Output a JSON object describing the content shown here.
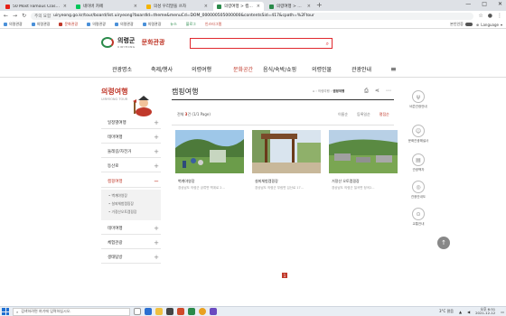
{
  "browser": {
    "tabs": [
      {
        "label": "50 Most Famous Classical I",
        "active": false,
        "favicon_color": "#e62117"
      },
      {
        "label": "네이버 카페",
        "active": false,
        "favicon_color": "#03c75a"
      },
      {
        "label": "의성 우리말을 쓰자",
        "active": false,
        "favicon_color": "#f4b400"
      },
      {
        "label": "의령여행 > 캠핑여행 - 의령군 문",
        "active": true,
        "favicon_color": "#2a8a4a"
      },
      {
        "label": "의령여행 > 캠핑여행 - 의령군 문",
        "active": false,
        "favicon_color": "#2a8a4a"
      }
    ],
    "url_security": "주의 요함",
    "url": "uiryeong.go.kr/tour/board/list.uiryeong?boardId=theme&menuCd=DOM_000000505000000&contentsSid=417&cpath=%2Ftour",
    "bookmarks": [
      "의령관광",
      "의령관광",
      "문화관광",
      "의령관광",
      "의령관광",
      "의령관광",
      "뉴스",
      "블로그",
      "인스타그램"
    ],
    "bookmark_right": [
      "본인인증",
      "Language"
    ]
  },
  "site": {
    "logo_ko": "의령군",
    "logo_en": "UIRYEONG",
    "logo_sub": "문화관광",
    "search_placeholder": "",
    "gnb": [
      "관광명소",
      "축제/행사",
      "의령여행",
      "문화공간",
      "음식/숙박/쇼핑",
      "의령인물",
      "관광안내"
    ],
    "gnb_active_index": 3
  },
  "snb": {
    "title": "의령여행",
    "title_en": "UIRYEONG TOUR",
    "items": [
      {
        "label": "일정별여행",
        "icon": "+"
      },
      {
        "label": "테마여행",
        "icon": "+"
      },
      {
        "label": "둘레길/자전거",
        "icon": "+"
      },
      {
        "label": "등산로",
        "icon": "+"
      },
      {
        "label": "캠핑여행",
        "icon": "−"
      },
      {
        "label": "테마여행",
        "icon": "+"
      },
      {
        "label": "체험관광",
        "icon": "+"
      },
      {
        "label": "생태탐방",
        "icon": "+"
      }
    ],
    "sub_items": [
      "• 벽계야영장",
      "• 설뫼체험캠핑장",
      "• 거정산오토캠핑장"
    ]
  },
  "content": {
    "page_title": "캠핑여행",
    "breadcrumb_home": "⌂",
    "breadcrumb_mid": "› 의령여행 ›",
    "breadcrumb_current": "캠핑여행",
    "count_prefix": "전체",
    "count_value": "3",
    "count_suffix": "건 (1/1 Page)",
    "sorts": [
      "이름순",
      "등록일순",
      "평점순"
    ],
    "cards": [
      {
        "title": "벽계야영장",
        "address": "경상남도 의령군 궁류면 벽계로 2..."
      },
      {
        "title": "설뫼체험캠핑장",
        "address": "경상남도 의령군 부림면 입산로 17..."
      },
      {
        "title": "거정산 오토캠핑장",
        "address": "경상남도 의령군 칠곡면 정곡2..."
      }
    ],
    "page_number": "1"
  },
  "quick": [
    {
      "label": "비콘관광안내",
      "icon": "ψ"
    },
    {
      "label": "문화관광해설사",
      "icon": "☺"
    },
    {
      "label": "관광책자",
      "icon": "▤"
    },
    {
      "label": "관광안내도",
      "icon": "◎"
    },
    {
      "label": "교통안내",
      "icon": "⊙"
    }
  ],
  "taskbar": {
    "search_placeholder": "검색하려면 여기에 입력하십시오.",
    "weather": "3°C 맑음",
    "time": "오후 6:51",
    "date": "2021-12-12"
  }
}
